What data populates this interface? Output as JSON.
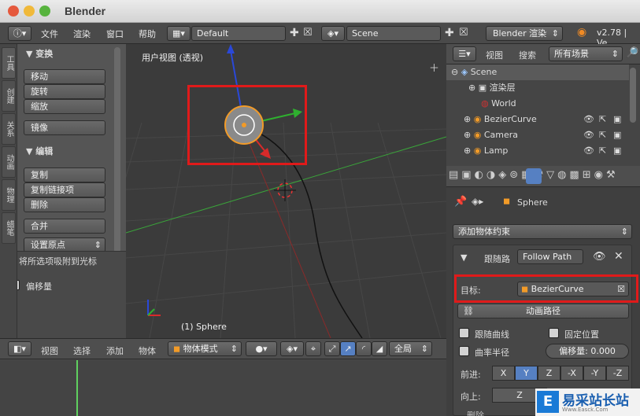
{
  "window": {
    "title": "Blender"
  },
  "topbar": {
    "menus": [
      "文件",
      "渲染",
      "窗口",
      "帮助"
    ],
    "layout": "Default",
    "scene": "Scene",
    "engine": "Blender 渲染",
    "version": "v2.78 | Ve"
  },
  "toolshelf": {
    "tabs": [
      "工具",
      "创建",
      "关系",
      "动画",
      "物理",
      "蜡笔"
    ],
    "transform_header": "▼ 变换",
    "transform_buttons": [
      "移动",
      "旋转",
      "缩放"
    ],
    "mirror": "镜像",
    "edit_header": "▼ 编辑",
    "edit_buttons": [
      "复制",
      "复制链接项",
      "删除"
    ],
    "join": "合并",
    "set_origin": "设置原点",
    "snap_header": "▼ 将所选项吸附到光标",
    "offset": "偏移量"
  },
  "viewport": {
    "label": "用户视图 (透视)",
    "object_label": "(1) Sphere"
  },
  "outliner": {
    "view": "视图",
    "search": "搜索",
    "filter": "所有场景",
    "items": [
      "Scene",
      "渲染层",
      "World",
      "BezierCurve",
      "Camera",
      "Lamp"
    ]
  },
  "properties": {
    "object": "Sphere",
    "add_constraint": "添加物体约束",
    "constraint_name": "跟随路",
    "constraint_type": "Follow Path",
    "target_label": "目标:",
    "target_value": "BezierCurve",
    "animate_path": "动画路径",
    "follow_curve": "跟随曲线",
    "fixed_position": "固定位置",
    "curve_radius": "曲率半径",
    "offset": "偏移量: 0.000",
    "forward": "前进:",
    "forward_axes": [
      "X",
      "Y",
      "Z",
      "-X",
      "-Y",
      "-Z"
    ],
    "up": "向上:",
    "up_axis": "Z",
    "bottom": "删除"
  },
  "timeline": {
    "menus": [
      "视图",
      "选择",
      "添加",
      "物体"
    ],
    "mode": "物体模式",
    "global": "全局"
  },
  "watermark": {
    "text": "易采站长站",
    "sub": "Www.Easck.Com"
  },
  "colors": {
    "selection": "#e01a1a",
    "accent": "#5680c2"
  }
}
